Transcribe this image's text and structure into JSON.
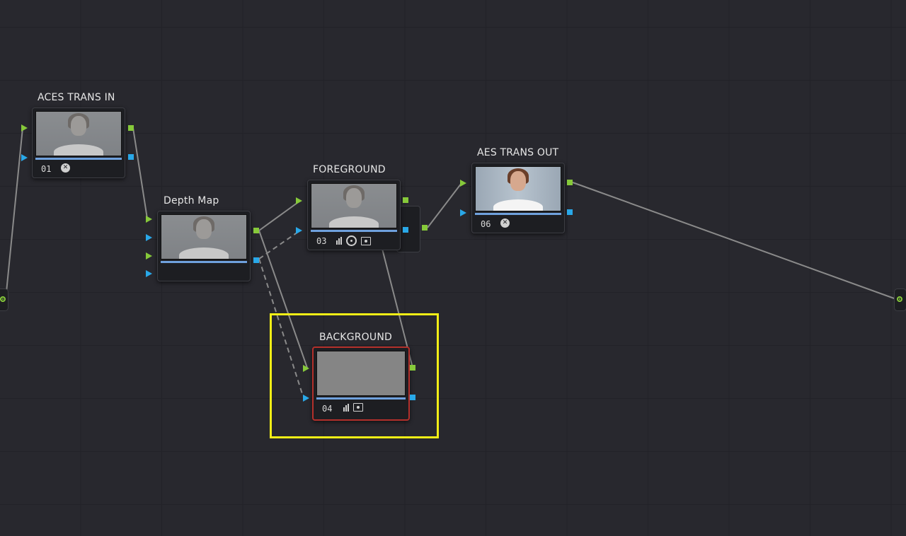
{
  "nodes": {
    "aces_in": {
      "title": "ACES TRANS IN",
      "number": "01"
    },
    "depth_map": {
      "title": "Depth Map"
    },
    "foreground": {
      "title": "FOREGROUND",
      "number": "03"
    },
    "background": {
      "title": "BACKGROUND",
      "number": "04"
    },
    "aes_out": {
      "title": "AES TRANS OUT",
      "number": "06"
    }
  },
  "colors": {
    "canvas": "#28282e",
    "rgb_port": "#86c93a",
    "alpha_port": "#29a8e8",
    "selection_border": "#b3302b",
    "highlight": "#f2ee16",
    "wire": "#8a8a8a"
  }
}
